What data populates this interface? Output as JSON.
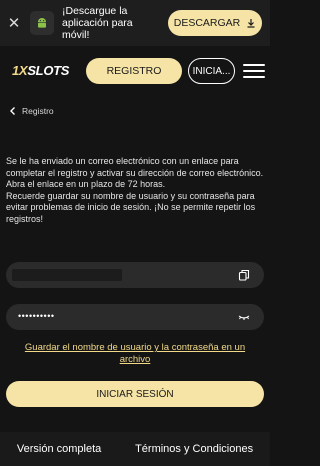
{
  "app_banner": {
    "close_icon": "close-icon",
    "platform_icon": "android-icon",
    "message": "¡Descargue la aplicación para móvil!",
    "download_label": "DESCARGAR",
    "download_icon": "download-icon"
  },
  "header": {
    "logo_part1": "1X",
    "logo_part2": "SLOTS",
    "register_label": "REGISTRO",
    "login_label": "INICIA...",
    "menu_icon": "hamburger-menu-icon"
  },
  "breadcrumb": {
    "back_icon": "chevron-left-icon",
    "label": "Registro"
  },
  "info": {
    "line1": "Se le ha enviado un correo electrónico con un enlace para completar el registro y activar su dirección de correo electrónico.",
    "line2": "Abra el enlace en un plazo de 72 horas.",
    "line3": "Recuerde guardar su nombre de usuario y su contraseña para evitar problemas de inicio de sesión. ¡No se permite repetir los registros!"
  },
  "credentials": {
    "password_mask": "••••••••••",
    "copy_icon": "copy-icon",
    "eye_icon": "eye-closed-icon"
  },
  "save_link": "Guardar el nombre de usuario y la contraseña en un archivo",
  "login_button": "INICIAR SESIÓN",
  "footer": {
    "full_version": "Versión completa",
    "terms": "Términos y Condiciones"
  },
  "colors": {
    "accent": "#f5e4a6",
    "link": "#f2d98a",
    "background": "#141414",
    "field": "#2b2b2b"
  }
}
